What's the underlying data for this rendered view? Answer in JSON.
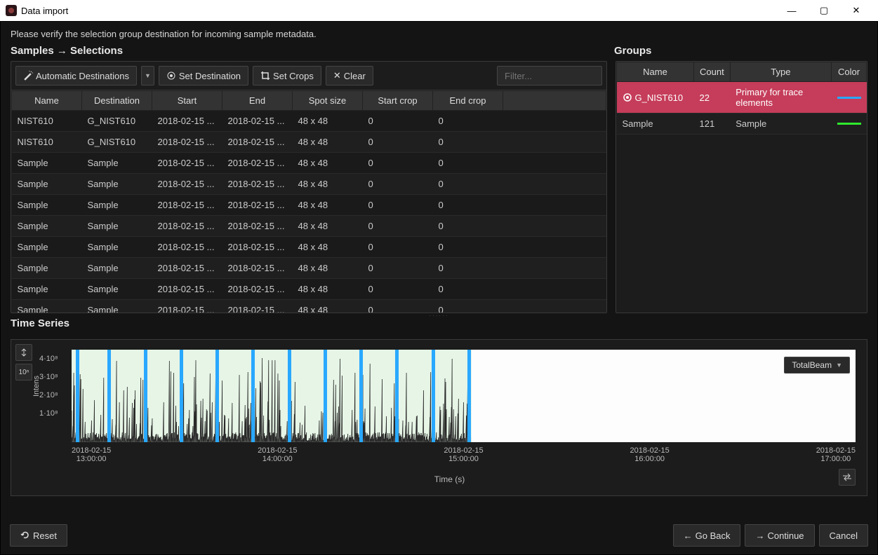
{
  "window": {
    "title": "Data import",
    "min": "—",
    "max": "▢",
    "close": "✕"
  },
  "instruction": "Please verify the selection group destination for incoming sample metadata.",
  "section_samples_title": "Samples → Selections",
  "section_groups_title": "Groups",
  "section_timeseries_title": "Time Series",
  "toolbar": {
    "auto_dest": "Automatic Destinations",
    "set_dest": "Set Destination",
    "set_crops": "Set Crops",
    "clear": "Clear",
    "filter_placeholder": "Filter..."
  },
  "samples_headers": {
    "name": "Name",
    "dest": "Destination",
    "start": "Start",
    "end": "End",
    "spot": "Spot size",
    "start_crop": "Start crop",
    "end_crop": "End crop"
  },
  "samples_rows": [
    {
      "name": "NIST610",
      "dest": "G_NIST610",
      "start": "2018-02-15 ...",
      "end": "2018-02-15 ...",
      "spot": "48 x 48",
      "sc": "0",
      "ec": "0"
    },
    {
      "name": "NIST610",
      "dest": "G_NIST610",
      "start": "2018-02-15 ...",
      "end": "2018-02-15 ...",
      "spot": "48 x 48",
      "sc": "0",
      "ec": "0"
    },
    {
      "name": "Sample",
      "dest": "Sample",
      "start": "2018-02-15 ...",
      "end": "2018-02-15 ...",
      "spot": "48 x 48",
      "sc": "0",
      "ec": "0"
    },
    {
      "name": "Sample",
      "dest": "Sample",
      "start": "2018-02-15 ...",
      "end": "2018-02-15 ...",
      "spot": "48 x 48",
      "sc": "0",
      "ec": "0"
    },
    {
      "name": "Sample",
      "dest": "Sample",
      "start": "2018-02-15 ...",
      "end": "2018-02-15 ...",
      "spot": "48 x 48",
      "sc": "0",
      "ec": "0"
    },
    {
      "name": "Sample",
      "dest": "Sample",
      "start": "2018-02-15 ...",
      "end": "2018-02-15 ...",
      "spot": "48 x 48",
      "sc": "0",
      "ec": "0"
    },
    {
      "name": "Sample",
      "dest": "Sample",
      "start": "2018-02-15 ...",
      "end": "2018-02-15 ...",
      "spot": "48 x 48",
      "sc": "0",
      "ec": "0"
    },
    {
      "name": "Sample",
      "dest": "Sample",
      "start": "2018-02-15 ...",
      "end": "2018-02-15 ...",
      "spot": "48 x 48",
      "sc": "0",
      "ec": "0"
    },
    {
      "name": "Sample",
      "dest": "Sample",
      "start": "2018-02-15 ...",
      "end": "2018-02-15 ...",
      "spot": "48 x 48",
      "sc": "0",
      "ec": "0"
    },
    {
      "name": "Sample",
      "dest": "Sample",
      "start": "2018-02-15 ...",
      "end": "2018-02-15 ...",
      "spot": "48 x 48",
      "sc": "0",
      "ec": "0"
    }
  ],
  "groups_headers": {
    "name": "Name",
    "count": "Count",
    "type": "Type",
    "color": "Color"
  },
  "groups_rows": [
    {
      "name": "G_NIST610",
      "count": "22",
      "type": "Primary for trace elements",
      "color": "#29a8ff",
      "selected": true
    },
    {
      "name": "Sample",
      "count": "121",
      "type": "Sample",
      "color": "#2eea2e",
      "selected": false
    }
  ],
  "timeseries": {
    "ylabel": "Intens",
    "yticks": [
      "4·10⁸",
      "3·10⁸",
      "2·10⁸",
      "1·10⁸"
    ],
    "xlabel": "Time (s)",
    "xticks": [
      {
        "date": "2018-02-15",
        "time": "13:00:00"
      },
      {
        "date": "2018-02-15",
        "time": "14:00:00"
      },
      {
        "date": "2018-02-15",
        "time": "15:00:00"
      },
      {
        "date": "2018-02-15",
        "time": "16:00:00"
      },
      {
        "date": "2018-02-15",
        "time": "17:00:00"
      }
    ],
    "legend": "TotalBeam",
    "tool_log": "10ⁿ"
  },
  "footer": {
    "reset": "Reset",
    "go_back": "Go Back",
    "continue": "Continue",
    "cancel": "Cancel"
  },
  "chart_data": {
    "type": "line",
    "title": "Time Series",
    "xlabel": "Time (s)",
    "ylabel": "Intensity",
    "ylim": [
      0,
      450000000.0
    ],
    "xrange_displayed": [
      "2018-02-15 12:40:00",
      "2018-02-15 17:30:00"
    ],
    "data_extent": [
      "2018-02-15 12:40:00",
      "2018-02-15 15:15:00"
    ],
    "series": [
      {
        "name": "TotalBeam",
        "approx_peak_intensity": 400000000.0,
        "approx_baseline": 0.0,
        "note": "Dense spiky ablation trace; vertical blue markers denote sample segment boundaries."
      }
    ],
    "markers_approx_times": [
      "12:42",
      "12:56",
      "13:10",
      "13:24",
      "13:38",
      "13:52",
      "14:06",
      "14:20",
      "14:34",
      "14:48",
      "15:02",
      "15:15"
    ]
  }
}
